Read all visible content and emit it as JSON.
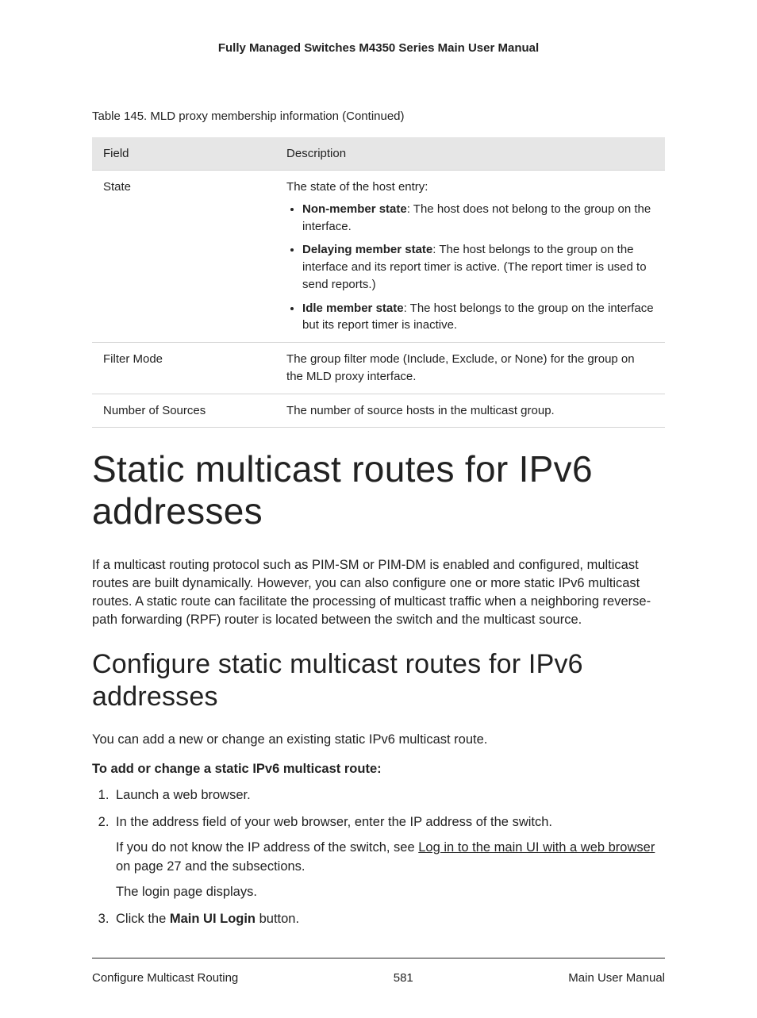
{
  "header": {
    "title": "Fully Managed Switches M4350 Series Main User Manual"
  },
  "table": {
    "caption": "Table 145. MLD proxy membership information (Continued)",
    "head": {
      "col1": "Field",
      "col2": "Description"
    },
    "rows": [
      {
        "field": "State",
        "intro": "The state of the host entry:",
        "items": [
          {
            "label": "Non-member state",
            "text": ": The host does not belong to the group on the interface."
          },
          {
            "label": "Delaying member state",
            "text": ": The host belongs to the group on the interface and its report timer is active. (The report timer is used to send reports.)"
          },
          {
            "label": "Idle member state",
            "text": ": The host belongs to the group on the interface but its report timer is inactive."
          }
        ]
      },
      {
        "field": "Filter Mode",
        "desc": "The group filter mode (Include, Exclude, or None) for the group on the MLD proxy interface."
      },
      {
        "field": "Number of Sources",
        "desc": "The number of source hosts in the multicast group."
      }
    ]
  },
  "h1": "Static multicast routes for IPv6 addresses",
  "para1": "If a multicast routing protocol such as PIM-SM or PIM-DM is enabled and configured, multicast routes are built dynamically. However, you can also configure one or more static IPv6 multicast routes. A static route can facilitate the processing of multicast traffic when a neighboring reverse-path forwarding (RPF) router is located between the switch and the multicast source.",
  "h2": "Configure static multicast routes for IPv6 addresses",
  "lead": "You can add a new or change an existing static IPv6 multicast route.",
  "task": "To add or change a static IPv6 multicast route:",
  "steps": {
    "s1": "Launch a web browser.",
    "s2a": "In the address field of your web browser, enter the IP address of the switch.",
    "s2b_pre": "If you do not know the IP address of the switch, see ",
    "s2b_link": "Log in to the main UI with a web browser",
    "s2b_post": " on page 27 and the subsections.",
    "s2c": "The login page displays.",
    "s3_pre": "Click the ",
    "s3_bold": "Main UI Login",
    "s3_post": " button."
  },
  "footer": {
    "left": "Configure Multicast Routing",
    "center": "581",
    "right": "Main User Manual"
  }
}
